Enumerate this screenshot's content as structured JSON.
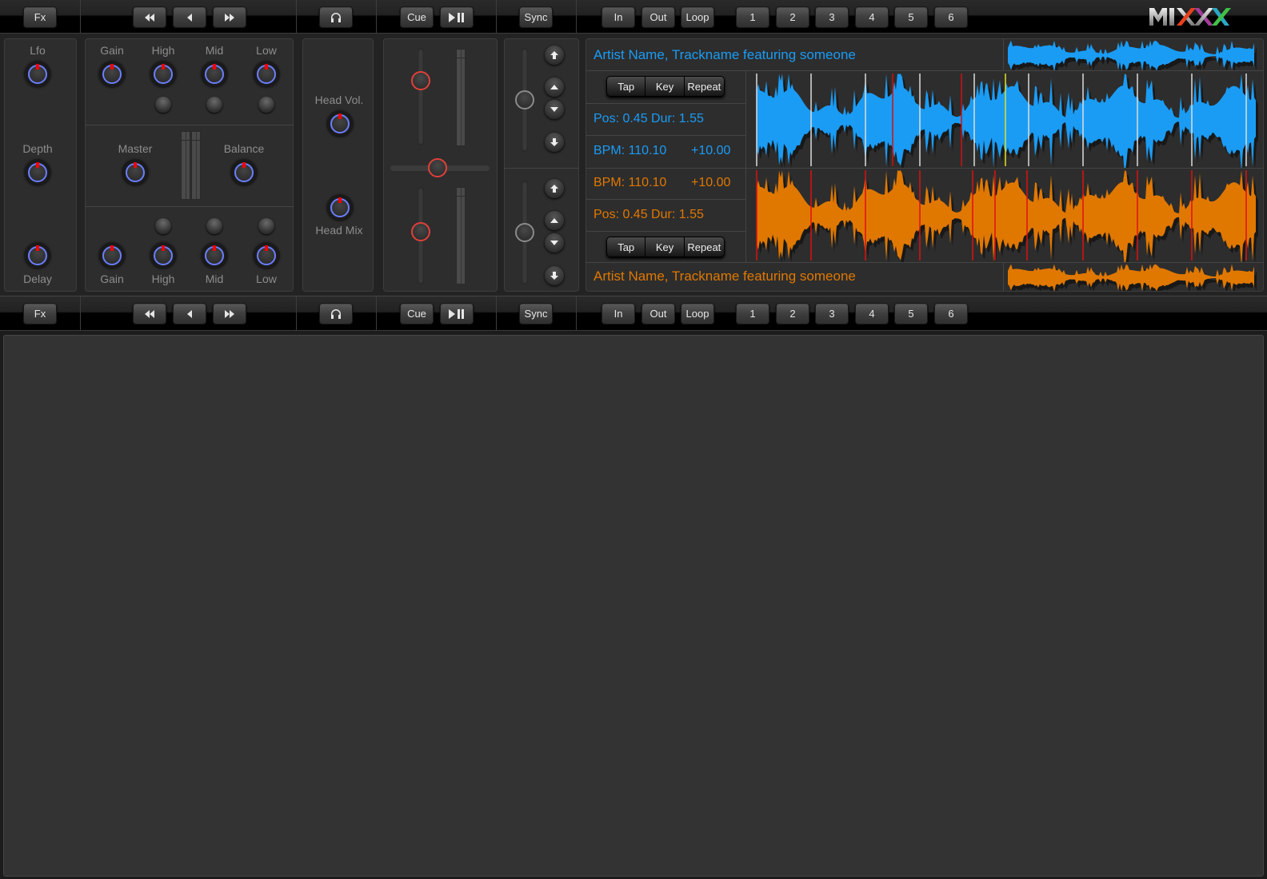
{
  "app": {
    "logo": "MIXXX"
  },
  "toolbar_top": {
    "fx": "Fx",
    "transport": [
      "rewind-icon",
      "back-icon",
      "fast-forward-icon"
    ],
    "headphone": "headphones-icon",
    "cue": "Cue",
    "play_pause": "play-pause-icon",
    "sync": "Sync",
    "loop": [
      "In",
      "Out",
      "Loop"
    ],
    "hotcues": [
      "1",
      "2",
      "3",
      "4",
      "5",
      "6"
    ]
  },
  "toolbar_bottom": {
    "fx": "Fx",
    "transport": [
      "rewind-icon",
      "back-icon",
      "fast-forward-icon"
    ],
    "headphone": "headphones-icon",
    "cue": "Cue",
    "play_pause": "play-pause-icon",
    "sync": "Sync",
    "loop": [
      "In",
      "Out",
      "Loop"
    ],
    "hotcues": [
      "1",
      "2",
      "3",
      "4",
      "5",
      "6"
    ]
  },
  "fx_panel": {
    "labels": [
      "Lfo",
      "Depth",
      "Delay"
    ]
  },
  "mixer": {
    "eq_top_labels": [
      "Gain",
      "High",
      "Mid",
      "Low"
    ],
    "eq_bottom_labels": [
      "Gain",
      "High",
      "Mid",
      "Low"
    ],
    "master_label": "Master",
    "balance_label": "Balance"
  },
  "headphone_panel": {
    "head_vol": "Head Vol.",
    "head_mix": "Head Mix"
  },
  "faders": {
    "channel1_level": 0.7,
    "channel2_level": 0.55,
    "crossfader": 0.47
  },
  "pitch": {
    "deck1_rate": 0.5,
    "deck2_rate": 0.5
  },
  "deck1": {
    "color": "#1a9cf5",
    "title": "Artist Name, Trackname featuring someone",
    "buttons": [
      "Tap",
      "Key",
      "Repeat"
    ],
    "position": "Pos: 0.45 Dur: 1.55",
    "bpm": "BPM: 110.10",
    "pitch_offset": "+10.00"
  },
  "deck2": {
    "color": "#e07800",
    "title": "Artist Name, Trackname featuring someone",
    "buttons": [
      "Tap",
      "Key",
      "Repeat"
    ],
    "position": "Pos: 0.45 Dur: 1.55",
    "bpm": "BPM: 110.10",
    "pitch_offset": "+10.00"
  }
}
